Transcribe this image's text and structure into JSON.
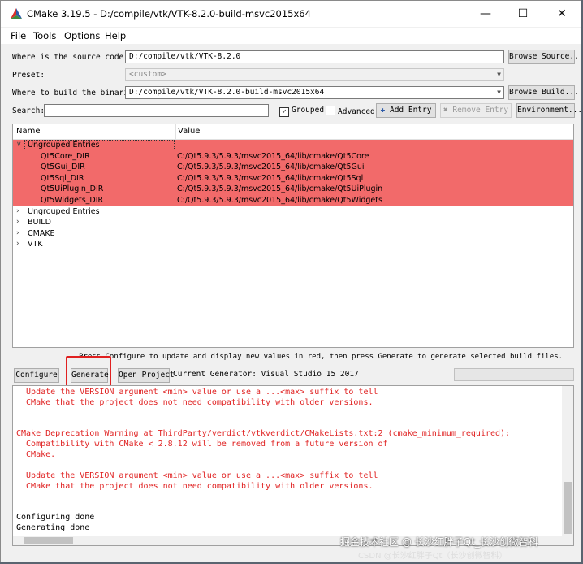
{
  "window": {
    "title": "CMake 3.19.5 - D:/compile/vtk/VTK-8.2.0-build-msvc2015x64",
    "minimize_icon": "minimize-icon",
    "maximize_icon": "maximize-icon",
    "close_icon": "close-icon"
  },
  "menu": {
    "file": "File",
    "tools": "Tools",
    "options": "Options",
    "help": "Help"
  },
  "source": {
    "label": "Where is the source code:",
    "value": "D:/compile/vtk/VTK-8.2.0",
    "browse": "Browse Source..."
  },
  "preset": {
    "label": "Preset:",
    "value": "<custom>"
  },
  "build": {
    "label": "Where to build the binaries:",
    "value": "D:/compile/vtk/VTK-8.2.0-build-msvc2015x64",
    "browse": "Browse Build..."
  },
  "search": {
    "label": "Search:",
    "value": "",
    "grouped_label": "Grouped",
    "grouped_checked": true,
    "advanced_label": "Advanced",
    "advanced_checked": false,
    "add_entry": "Add Entry",
    "remove_entry": "Remove Entry",
    "environment": "Environment..."
  },
  "tree": {
    "col_name": "Name",
    "col_value": "Value",
    "rows": [
      {
        "name": "Ungrouped Entries",
        "value": "",
        "level": 0,
        "red": true,
        "expanded": true
      },
      {
        "name": "Qt5Core_DIR",
        "value": "C:/Qt5.9.3/5.9.3/msvc2015_64/lib/cmake/Qt5Core",
        "level": 1,
        "red": true
      },
      {
        "name": "Qt5Gui_DIR",
        "value": "C:/Qt5.9.3/5.9.3/msvc2015_64/lib/cmake/Qt5Gui",
        "level": 1,
        "red": true
      },
      {
        "name": "Qt5Sql_DIR",
        "value": "C:/Qt5.9.3/5.9.3/msvc2015_64/lib/cmake/Qt5Sql",
        "level": 1,
        "red": true
      },
      {
        "name": "Qt5UiPlugin_DIR",
        "value": "C:/Qt5.9.3/5.9.3/msvc2015_64/lib/cmake/Qt5UiPlugin",
        "level": 1,
        "red": true
      },
      {
        "name": "Qt5Widgets_DIR",
        "value": "C:/Qt5.9.3/5.9.3/msvc2015_64/lib/cmake/Qt5Widgets",
        "level": 1,
        "red": true
      },
      {
        "name": "Ungrouped Entries",
        "value": "",
        "level": 0,
        "red": false,
        "expanded": false
      },
      {
        "name": "BUILD",
        "value": "",
        "level": 0,
        "red": false,
        "expanded": false
      },
      {
        "name": "CMAKE",
        "value": "",
        "level": 0,
        "red": false,
        "expanded": false
      },
      {
        "name": "VTK",
        "value": "",
        "level": 0,
        "red": false,
        "expanded": false
      }
    ]
  },
  "note": "Press Configure to update and display new values in red, then press Generate to generate selected build files.",
  "actions": {
    "configure": "Configure",
    "generate": "Generate",
    "open_project": "Open Project",
    "current_generator": "Current Generator: Visual Studio 15 2017"
  },
  "output": {
    "lines": [
      {
        "text": "  Update the VERSION argument <min> value or use a ...<max> suffix to tell",
        "red": true
      },
      {
        "text": "  CMake that the project does not need compatibility with older versions.",
        "red": true
      },
      {
        "text": "",
        "red": false
      },
      {
        "text": "",
        "red": false
      },
      {
        "text": "CMake Deprecation Warning at ThirdParty/verdict/vtkverdict/CMakeLists.txt:2 (cmake_minimum_required):",
        "red": true
      },
      {
        "text": "  Compatibility with CMake < 2.8.12 will be removed from a future version of",
        "red": true
      },
      {
        "text": "  CMake.",
        "red": true
      },
      {
        "text": "",
        "red": false
      },
      {
        "text": "  Update the VERSION argument <min> value or use a ...<max> suffix to tell",
        "red": true
      },
      {
        "text": "  CMake that the project does not need compatibility with older versions.",
        "red": true
      },
      {
        "text": "",
        "red": false
      },
      {
        "text": "",
        "red": false
      },
      {
        "text": "Configuring done",
        "red": false
      },
      {
        "text": "Generating done",
        "red": false
      }
    ]
  },
  "watermark": {
    "line1": "掘金技术社区 @ 长沙红胖子Qt_长沙创微智科",
    "line2": "CSDN @长沙红胖子Qt（长沙创微智科）"
  },
  "colors": {
    "highlight_row": "#f26a6a",
    "error_text": "#e02222",
    "annotation_box": "#e02020",
    "logo_red": "#d8312b",
    "logo_green": "#3d8c40",
    "logo_blue": "#2c5aa8"
  }
}
